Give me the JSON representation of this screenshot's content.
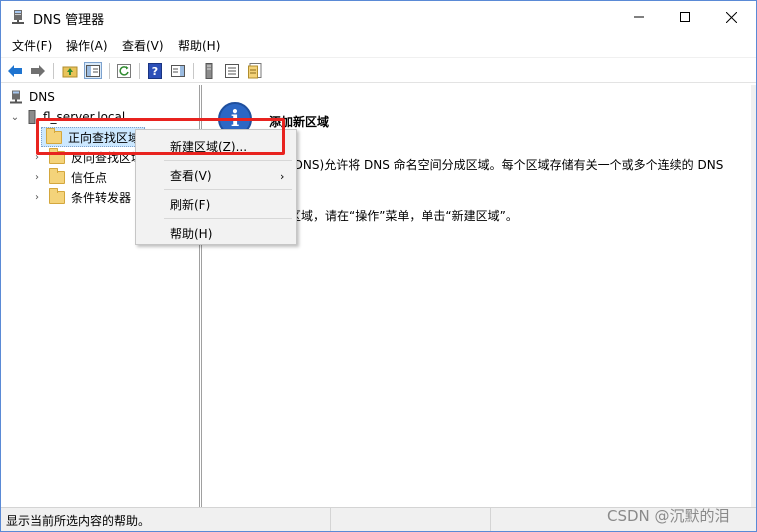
{
  "window": {
    "title": "DNS 管理器"
  },
  "menubar": {
    "items": [
      "文件(F)",
      "操作(A)",
      "查看(V)",
      "帮助(H)"
    ]
  },
  "toolbar": {
    "icons": [
      "back-arrow-icon",
      "forward-arrow-icon",
      "up-folder-icon",
      "show-hide-tree-icon",
      "refresh-icon",
      "help-icon",
      "action-pane-icon",
      "server-icon",
      "list-icon",
      "properties-icon"
    ]
  },
  "tree": {
    "root": "DNS",
    "server": "fl_server.local",
    "items": [
      "正向查找区域",
      "反向查找区域",
      "信任点",
      "条件转发器"
    ]
  },
  "content": {
    "heading": "添加新区域",
    "line1": "(DNS)允许将 DNS 命名空间分成区域。每个区域存储有关一个或多个连续的 DNS",
    "line2": "区域，请在“操作”菜单，单击“新建区域”。"
  },
  "context_menu": {
    "items": [
      "新建区域(Z)...",
      "查看(V)",
      "刷新(F)",
      "帮助(H)"
    ]
  },
  "status": {
    "text": "显示当前所选内容的帮助。"
  },
  "watermark": {
    "text": "CSDN @沉默的泪"
  },
  "colors": {
    "highlight": "#e8231f",
    "selection": "#cce8ff",
    "accent": "#2c67c4"
  }
}
